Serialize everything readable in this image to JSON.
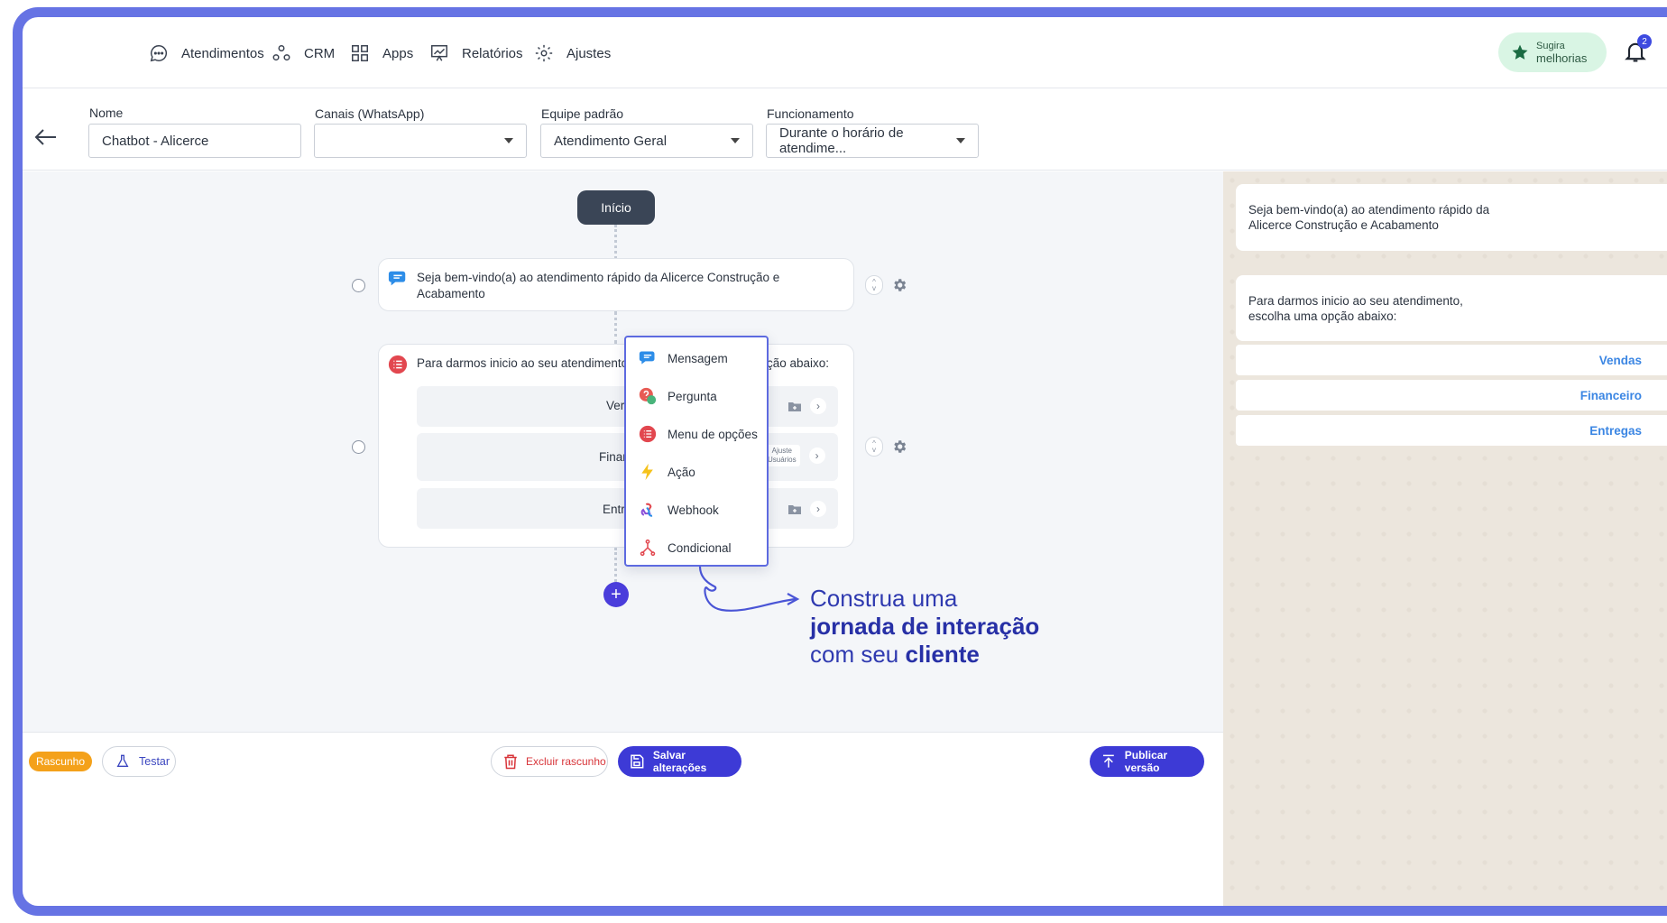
{
  "nav": {
    "items": [
      {
        "label": "Atendimentos",
        "icon": "chat-bubble-icon"
      },
      {
        "label": "CRM",
        "icon": "crm-nodes-icon"
      },
      {
        "label": "Apps",
        "icon": "apps-grid-icon"
      },
      {
        "label": "Relatórios",
        "icon": "reports-chart-icon"
      },
      {
        "label": "Ajustes",
        "icon": "gear-icon"
      }
    ],
    "suggest_line1": "Sugira",
    "suggest_line2": "melhorias",
    "notification_count": "2"
  },
  "form": {
    "name_label": "Nome",
    "name_value": "Chatbot - Alicerce",
    "channels_label": "Canais (WhatsApp)",
    "channels_value": "",
    "team_label": "Equipe padrão",
    "team_value": "Atendimento Geral",
    "schedule_label": "Funcionamento",
    "schedule_value": "Durante o horário de atendime..."
  },
  "flow": {
    "start_label": "Início",
    "message_node_line1": "Seja bem-vindo(a) ao atendimento rápido da Alicerce Construção e",
    "message_node_line2": "Acabamento",
    "menu_node_left": "Para darmos inicio ao seu atendimento",
    "menu_node_right": "ção abaixo:",
    "options": [
      {
        "label_visible": "Ver"
      },
      {
        "label_visible": "Finan",
        "tag_line1": "Ajuste",
        "tag_line2": "Usuários"
      },
      {
        "label_visible": "Entr"
      }
    ]
  },
  "menu": {
    "items": [
      {
        "label": "Mensagem",
        "icon": "message-icon"
      },
      {
        "label": "Pergunta",
        "icon": "question-icon"
      },
      {
        "label": "Menu de opções",
        "icon": "options-list-icon"
      },
      {
        "label": "Ação",
        "icon": "lightning-icon"
      },
      {
        "label": "Webhook",
        "icon": "webhook-icon"
      },
      {
        "label": "Condicional",
        "icon": "conditional-icon"
      }
    ]
  },
  "promo": {
    "line1": "Construa uma",
    "line2": "jornada de interação",
    "line3_plain": "com seu ",
    "line3_bold": "cliente"
  },
  "preview": {
    "bubble1_line1": "Seja bem-vindo(a) ao atendimento rápido da",
    "bubble1_line2": "Alicerce Construção e Acabamento",
    "bubble2_line1": "Para darmos inicio ao seu atendimento,",
    "bubble2_line2": "escolha uma opção abaixo:",
    "buttons": [
      "Vendas",
      "Financeiro",
      "Entregas"
    ]
  },
  "footer": {
    "draft_badge": "Rascunho",
    "test_label": "Testar",
    "delete_label": "Excluir rascunho",
    "save_label": "Salvar alterações",
    "publish_label": "Publicar versão"
  },
  "colors": {
    "accent": "#3d3ad6",
    "frame": "#6673e4",
    "draft": "#f4a11a",
    "danger": "#d8353a",
    "start_node": "#3a4556"
  }
}
